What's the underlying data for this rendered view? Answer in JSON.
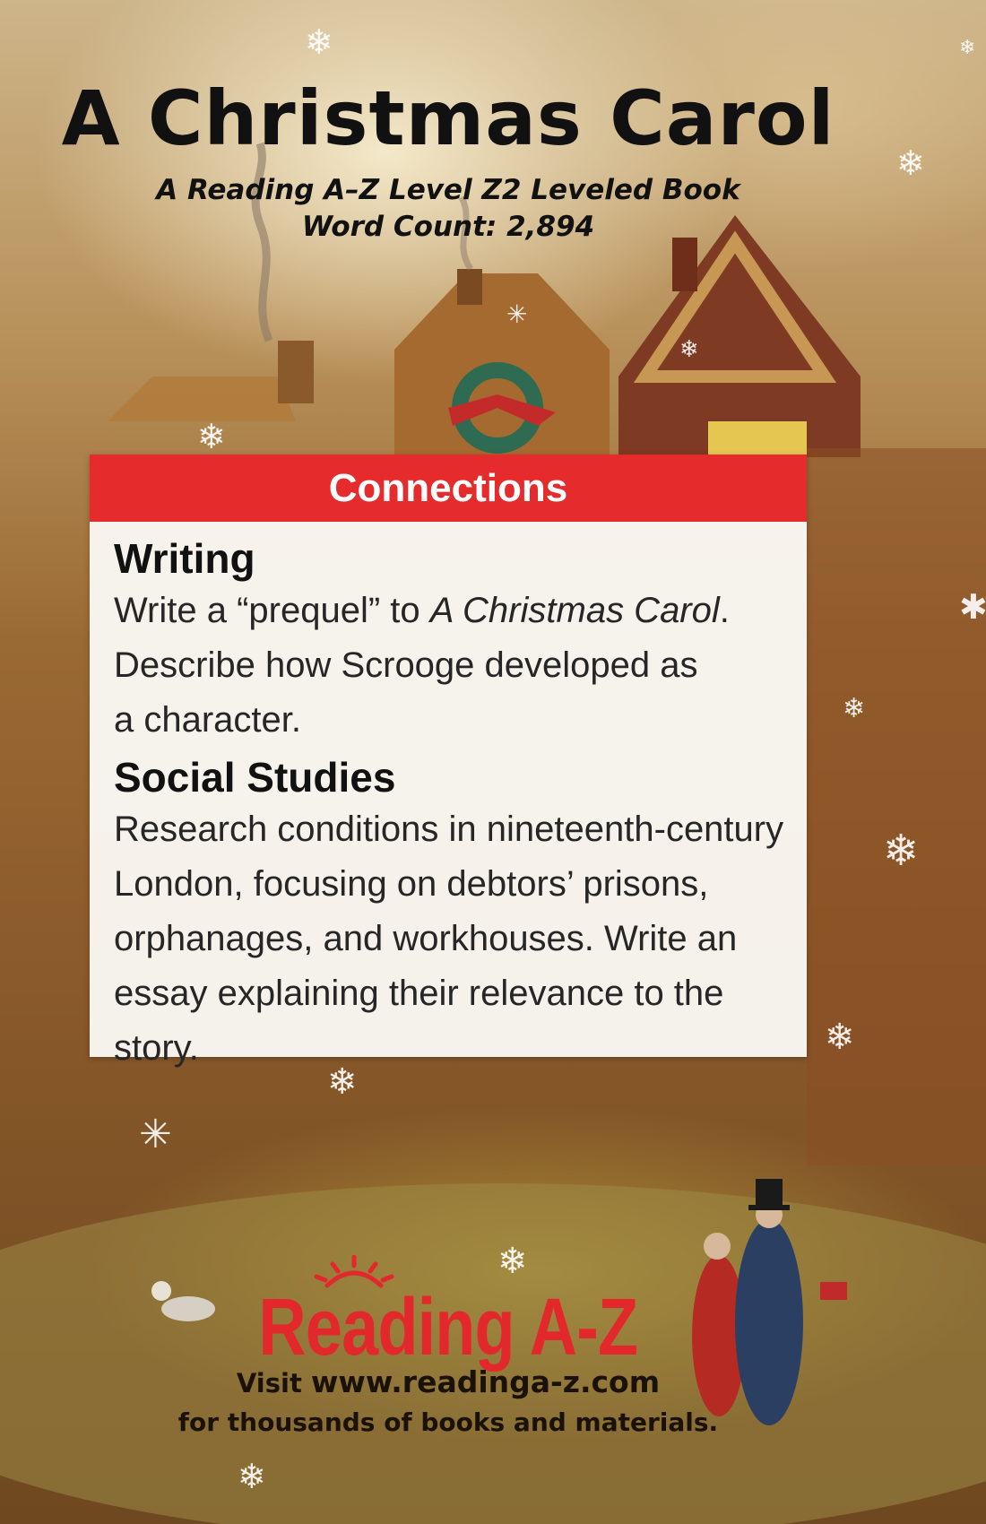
{
  "cover": {
    "title": "A Christmas Carol",
    "subtitle": "A Reading A–Z Level Z2 Leveled Book",
    "word_count": "Word Count: 2,894"
  },
  "connections": {
    "header": "Connections",
    "sections": [
      {
        "heading": "Writing",
        "lines": [
          "Write a “prequel” to ",
          "A Christmas Carol",
          ".",
          "Describe how Scrooge developed as",
          "a character."
        ]
      },
      {
        "heading": "Social Studies",
        "lines": [
          "Research conditions in nineteenth-century",
          "London, focusing on debtors’ prisons,",
          "orphanages, and workhouses. Write an",
          "essay explaining their relevance to the story."
        ]
      }
    ]
  },
  "footer": {
    "logo": "Reading A-Z",
    "visit_prefix": "Visit ",
    "url": "www.readinga-z.com",
    "tagline": "for thousands of books and materials."
  },
  "colors": {
    "header_red": "#e52b2b",
    "logo_red": "#e3282c"
  }
}
